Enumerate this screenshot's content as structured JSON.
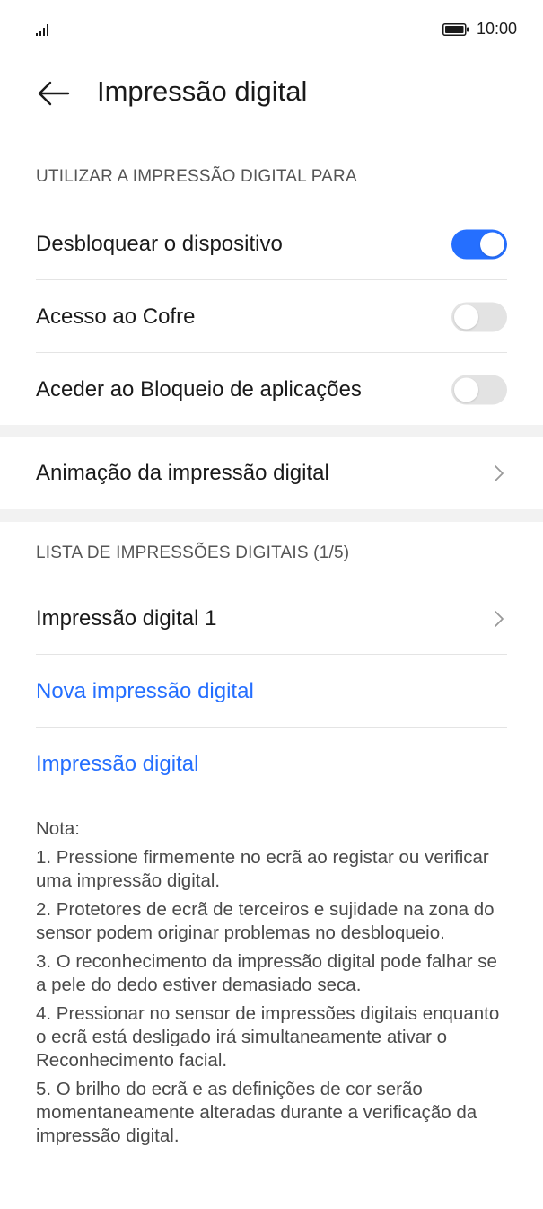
{
  "status_bar": {
    "time": "10:00",
    "signal_icon": "signal-bars-icon",
    "battery_icon": "battery-icon"
  },
  "header": {
    "title": "Impressão digital",
    "back_icon": "arrow-left-icon"
  },
  "section_use": {
    "title": "UTILIZAR A IMPRESSÃO DIGITAL PARA",
    "items": [
      {
        "label": "Desbloquear o dispositivo",
        "enabled": true
      },
      {
        "label": "Acesso ao Cofre",
        "enabled": false
      },
      {
        "label": "Aceder ao Bloqueio de aplicações",
        "enabled": false
      }
    ]
  },
  "animation": {
    "label": "Animação da impressão digital"
  },
  "section_list": {
    "title": "LISTA DE IMPRESSÕES DIGITAIS (1/5)",
    "fingerprint_item": "Impressão digital 1",
    "add_new": "Nova impressão digital",
    "id_link": "Impressão digital"
  },
  "note": {
    "heading": "Nota:",
    "items": [
      "1. Pressione firmemente no ecrã ao registar ou verificar uma impressão digital.",
      "2. Protetores de ecrã de terceiros e sujidade na zona do sensor podem originar problemas no desbloqueio.",
      "3. O reconhecimento da impressão digital pode falhar se a pele do dedo estiver demasiado seca.",
      "4. Pressionar no sensor de impressões digitais enquanto o ecrã está desligado irá simultaneamente ativar o Reconhecimento facial.",
      "5. O brilho do ecrã e as definições de cor serão momentaneamente alteradas durante a verificação da impressão digital."
    ]
  },
  "colors": {
    "accent": "#256fff",
    "toggle_off": "#e3e3e3",
    "separator_band": "#f2f2f2"
  }
}
